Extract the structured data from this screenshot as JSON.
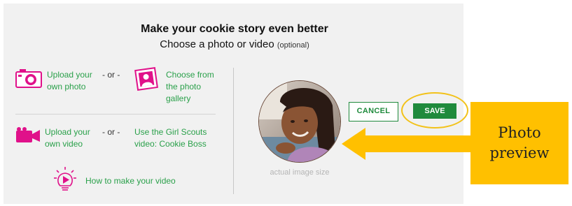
{
  "header": {
    "title": "Make your cookie story even better",
    "subtitle": "Choose a photo or video",
    "subtitle_optional": "(optional)"
  },
  "photo_options": {
    "upload_photo": [
      "Upload your",
      "own photo"
    ],
    "separator": "- or -",
    "gallery": [
      "Choose from",
      "the photo",
      "gallery"
    ]
  },
  "video_options": {
    "upload_video": [
      "Upload your",
      "own video"
    ],
    "separator": "- or -",
    "girl_scouts_video": [
      "Use the Girl Scouts",
      "video: Cookie Boss"
    ]
  },
  "howto": {
    "label": "How to make your video"
  },
  "preview": {
    "caption": "actual image size"
  },
  "actions": {
    "cancel": "CANCEL",
    "save": "SAVE"
  },
  "callout": {
    "lines": [
      "Photo",
      "preview"
    ]
  },
  "colors": {
    "accent_green": "#2aa04a",
    "button_green": "#1f8a3c",
    "icon_magenta": "#e0118a",
    "callout_gold": "#ffc000",
    "panel_bg": "#f1f1f1"
  },
  "icons": [
    "camera-icon",
    "photo-gallery-icon",
    "video-camera-icon",
    "lightbulb-play-icon"
  ]
}
